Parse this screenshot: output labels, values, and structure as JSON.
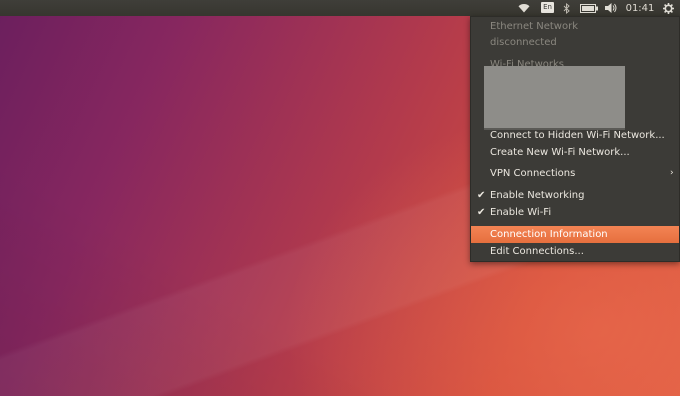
{
  "topbar": {
    "language": "En",
    "clock": "01:41"
  },
  "menu": {
    "ethernet_header": "Ethernet Network",
    "ethernet_status": "disconnected",
    "wifi_header": "Wi-Fi Networks",
    "connect_hidden": "Connect to Hidden Wi-Fi Network...",
    "create_new": "Create New Wi-Fi Network...",
    "vpn": "VPN Connections",
    "enable_networking": "Enable Networking",
    "enable_wifi": "Enable Wi-Fi",
    "connection_info": "Connection Information",
    "edit_connections": "Edit Connections...",
    "check_glyph": "✔",
    "arrow_glyph": "›"
  },
  "colors": {
    "highlight": "#f07746",
    "menu_bg": "#3c3b37",
    "panel_bg": "#3a3935"
  },
  "icons": {
    "wifi": "wifi-icon",
    "bluetooth": "bluetooth-icon",
    "battery": "battery-icon",
    "volume": "volume-icon",
    "settings": "gear-icon"
  }
}
